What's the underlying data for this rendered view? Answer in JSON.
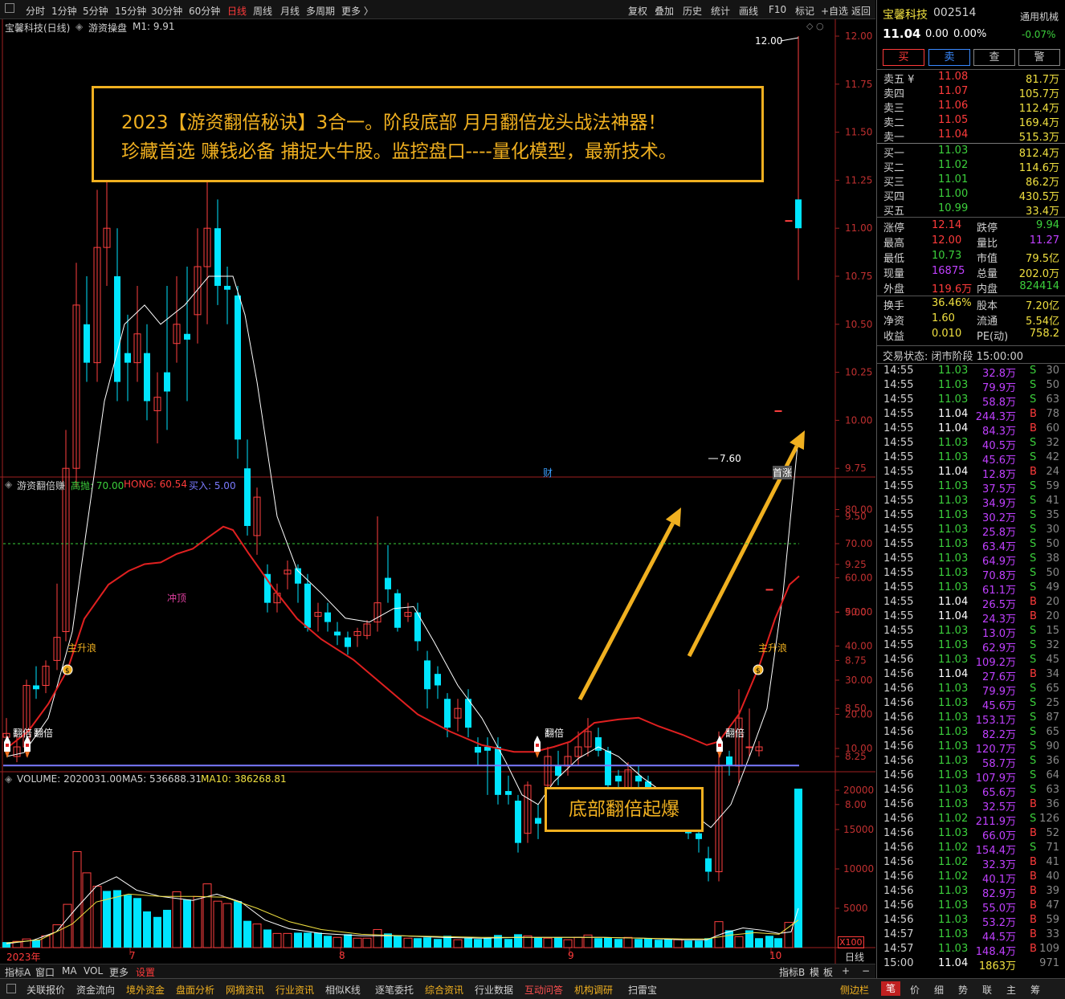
{
  "toolbar": {
    "left": [
      "分时",
      "1分钟",
      "5分钟",
      "15分钟",
      "30分钟",
      "60分钟",
      "日线",
      "周线",
      "月线",
      "多周期",
      "更多 〉"
    ],
    "selected_index": 6,
    "right": [
      "复权",
      "叠加",
      "历史",
      "统计",
      "画线",
      "F10",
      "标记",
      "+自选",
      "返回"
    ]
  },
  "main_chart": {
    "header": {
      "stock": "宝馨科技(日线)",
      "indicator": "游资操盘",
      "ma": "M1: 9.91"
    },
    "y_ticks": [
      "12.00",
      "11.75",
      "11.50",
      "11.25",
      "11.00",
      "10.75",
      "10.50",
      "10.25",
      "10.00",
      "9.75",
      "9.50",
      "9.25",
      "9.00",
      "8.75",
      "8.50",
      "8.25",
      "8.00"
    ],
    "annot_high": "12.00",
    "annot_low": "7.60",
    "marker_cai": "财",
    "marker_end": "首涨"
  },
  "promo": {
    "line1": "2023【游资翻倍秘诀】3合一。阶段底部 月月翻倍龙头战法神器！",
    "line2": "珍藏首选 赚钱必备 捕捉大牛股。监控盘口----量化模型，最新技术。"
  },
  "indicator": {
    "name": "游资翻倍赚",
    "p1_label": "高抛: 70.00",
    "p2_label": "HONG: 60.54",
    "p3_label": "买入: 5.00",
    "y_ticks": [
      "80.00",
      "70.00",
      "60.00",
      "50.00",
      "40.00",
      "30.00",
      "20.00",
      "10.00"
    ],
    "label_chongding": "冲顶",
    "label_zhushenglang": "主升浪",
    "label_fanbei": "翻倍"
  },
  "volume": {
    "header": "VOLUME: 2020031.00",
    "ma5": "MA5: 536688.31",
    "ma10": "MA10: 386268.81",
    "y_ticks": [
      "20000",
      "15000",
      "10000",
      "5000"
    ],
    "unit": "X100",
    "box_text": "底部翻倍起爆"
  },
  "x_axis": {
    "labels": [
      "2023年",
      "7",
      "8",
      "9",
      "10"
    ],
    "period": "日线"
  },
  "bottom_bar": {
    "left": [
      "指标A",
      "窗口",
      "MA",
      "VOL",
      "更多",
      "设置"
    ],
    "right": [
      "指标B",
      "模",
      "板",
      "+",
      "−"
    ]
  },
  "tabs": [
    "关联报价",
    "资金流向",
    "境外资金",
    "盘面分析",
    "网摘资讯",
    "行业资讯",
    "相似K线",
    "逐笔委托",
    "综合资讯",
    "行业数据",
    "互动问答",
    "机构调研",
    "扫雷宝",
    "侧边栏"
  ],
  "side_tabs": [
    "笔",
    "价",
    "细",
    "势",
    "联",
    "主",
    "筹"
  ],
  "quote": {
    "name": "宝馨科技",
    "code": "002514",
    "board": "通用机械",
    "price": "11.04",
    "change": "0.00",
    "pct": "0.00%",
    "board_pct": "-0.07%",
    "buttons": [
      "买",
      "卖",
      "查",
      "警"
    ],
    "sells": [
      {
        "label": "卖五 ¥",
        "price": "11.08",
        "vol": "81.7万"
      },
      {
        "label": "卖四",
        "price": "11.07",
        "vol": "105.7万"
      },
      {
        "label": "卖三",
        "price": "11.06",
        "vol": "112.4万"
      },
      {
        "label": "卖二",
        "price": "11.05",
        "vol": "169.4万"
      },
      {
        "label": "卖一",
        "price": "11.04",
        "vol": "515.3万"
      }
    ],
    "buys": [
      {
        "label": "买一",
        "price": "11.03",
        "vol": "812.4万"
      },
      {
        "label": "买二",
        "price": "11.02",
        "vol": "114.6万"
      },
      {
        "label": "买三",
        "price": "11.01",
        "vol": "86.2万"
      },
      {
        "label": "买四",
        "price": "11.00",
        "vol": "430.5万"
      },
      {
        "label": "买五",
        "price": "10.99",
        "vol": "33.4万"
      }
    ],
    "stats": [
      [
        "涨停",
        "12.14",
        "跌停",
        "9.94"
      ],
      [
        "最高",
        "12.00",
        "量比",
        "11.27"
      ],
      [
        "最低",
        "10.73",
        "市值",
        "79.5亿"
      ],
      [
        "现量",
        "16875",
        "总量",
        "202.0万"
      ],
      [
        "外盘",
        "119.6万",
        "内盘",
        "824414"
      ]
    ],
    "stats2": [
      [
        "换手",
        "36.46%",
        "股本",
        "7.20亿"
      ],
      [
        "净资",
        "1.60",
        "流通",
        "5.54亿"
      ],
      [
        "收益",
        "0.010",
        "PE(动)",
        "758.2"
      ]
    ],
    "status": "交易状态: 闭市阶段 15:00:00",
    "ticks": [
      [
        "14:55",
        "11.03",
        "32.8万",
        "S",
        "30"
      ],
      [
        "14:55",
        "11.03",
        "79.9万",
        "S",
        "50"
      ],
      [
        "14:55",
        "11.03",
        "58.8万",
        "S",
        "63"
      ],
      [
        "14:55",
        "11.04",
        "244.3万",
        "B",
        "78"
      ],
      [
        "14:55",
        "11.04",
        "84.3万",
        "B",
        "60"
      ],
      [
        "14:55",
        "11.03",
        "40.5万",
        "S",
        "32"
      ],
      [
        "14:55",
        "11.03",
        "45.6万",
        "S",
        "42"
      ],
      [
        "14:55",
        "11.04",
        "12.8万",
        "B",
        "24"
      ],
      [
        "14:55",
        "11.03",
        "37.5万",
        "S",
        "59"
      ],
      [
        "14:55",
        "11.03",
        "34.9万",
        "S",
        "41"
      ],
      [
        "14:55",
        "11.03",
        "30.2万",
        "S",
        "35"
      ],
      [
        "14:55",
        "11.03",
        "25.8万",
        "S",
        "30"
      ],
      [
        "14:55",
        "11.03",
        "63.4万",
        "S",
        "50"
      ],
      [
        "14:55",
        "11.03",
        "64.9万",
        "S",
        "38"
      ],
      [
        "14:55",
        "11.03",
        "70.8万",
        "S",
        "50"
      ],
      [
        "14:55",
        "11.03",
        "61.1万",
        "S",
        "49"
      ],
      [
        "14:55",
        "11.04",
        "26.5万",
        "B",
        "20"
      ],
      [
        "14:55",
        "11.04",
        "24.3万",
        "B",
        "20"
      ],
      [
        "14:55",
        "11.03",
        "13.0万",
        "S",
        "15"
      ],
      [
        "14:55",
        "11.03",
        "62.9万",
        "S",
        "32"
      ],
      [
        "14:56",
        "11.03",
        "109.2万",
        "S",
        "45"
      ],
      [
        "14:56",
        "11.04",
        "27.6万",
        "B",
        "34"
      ],
      [
        "14:56",
        "11.03",
        "79.9万",
        "S",
        "65"
      ],
      [
        "14:56",
        "11.03",
        "45.6万",
        "S",
        "25"
      ],
      [
        "14:56",
        "11.03",
        "153.1万",
        "S",
        "87"
      ],
      [
        "14:56",
        "11.03",
        "82.2万",
        "S",
        "65"
      ],
      [
        "14:56",
        "11.03",
        "120.7万",
        "S",
        "90"
      ],
      [
        "14:56",
        "11.03",
        "58.7万",
        "S",
        "36"
      ],
      [
        "14:56",
        "11.03",
        "107.9万",
        "S",
        "64"
      ],
      [
        "14:56",
        "11.03",
        "65.6万",
        "S",
        "63"
      ],
      [
        "14:56",
        "11.03",
        "32.5万",
        "B",
        "36"
      ],
      [
        "14:56",
        "11.02",
        "211.9万",
        "S",
        "126"
      ],
      [
        "14:56",
        "11.03",
        "66.0万",
        "B",
        "52"
      ],
      [
        "14:56",
        "11.02",
        "154.4万",
        "S",
        "71"
      ],
      [
        "14:56",
        "11.02",
        "32.3万",
        "B",
        "41"
      ],
      [
        "14:56",
        "11.02",
        "40.1万",
        "B",
        "40"
      ],
      [
        "14:56",
        "11.03",
        "82.9万",
        "B",
        "39"
      ],
      [
        "14:56",
        "11.03",
        "55.0万",
        "B",
        "47"
      ],
      [
        "14:56",
        "11.03",
        "53.2万",
        "B",
        "59"
      ],
      [
        "14:57",
        "11.03",
        "44.5万",
        "B",
        "33"
      ],
      [
        "14:57",
        "11.03",
        "148.4万",
        "B",
        "109"
      ],
      [
        "15:00",
        "11.04",
        "1863万",
        "",
        "971"
      ]
    ]
  }
}
